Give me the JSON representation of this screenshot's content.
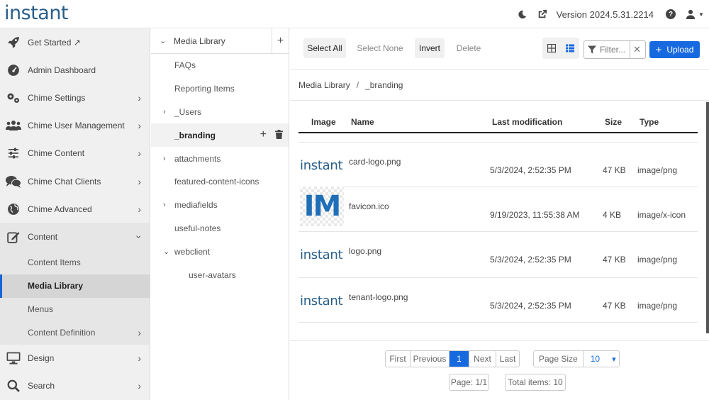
{
  "header": {
    "logo": "instant",
    "version": "Version 2024.5.31.2214"
  },
  "sidebar": {
    "items": [
      {
        "label": "Get Started ↗",
        "icon": "rocket-icon",
        "chevron": false
      },
      {
        "label": "Admin Dashboard",
        "icon": "gauge-icon",
        "chevron": false
      },
      {
        "label": "Chime Settings",
        "icon": "gears-icon",
        "chevron": true
      },
      {
        "label": "Chime User Management",
        "icon": "users-icon",
        "chevron": true
      },
      {
        "label": "Chime Content",
        "icon": "sliders-icon",
        "chevron": true
      },
      {
        "label": "Chime Chat Clients",
        "icon": "chat-icon",
        "chevron": true
      },
      {
        "label": "Chime Advanced",
        "icon": "globe-icon",
        "chevron": true
      },
      {
        "label": "Content",
        "icon": "edit-icon",
        "chevron": true
      }
    ],
    "content_sub": [
      {
        "label": "Content Items"
      },
      {
        "label": "Media Library"
      },
      {
        "label": "Menus"
      },
      {
        "label": "Content Definition"
      }
    ],
    "bottom_items": [
      {
        "label": "Design",
        "icon": "monitor-icon"
      },
      {
        "label": "Search",
        "icon": "search-icon"
      }
    ]
  },
  "tree": {
    "root": "Media Library",
    "rows": [
      {
        "label": "FAQs"
      },
      {
        "label": "Reporting Items"
      },
      {
        "label": "_Users"
      },
      {
        "label": "_branding"
      },
      {
        "label": "attachments"
      },
      {
        "label": "featured-content-icons"
      },
      {
        "label": "mediafields"
      },
      {
        "label": "useful-notes"
      },
      {
        "label": "webclient"
      },
      {
        "label": "user-avatars"
      }
    ]
  },
  "toolbar": {
    "select_all": "Select All",
    "select_none": "Select None",
    "invert": "Invert",
    "delete": "Delete",
    "filter_placeholder": "Filter...",
    "upload": "Upload"
  },
  "breadcrumb": {
    "root": "Media Library",
    "sep": "/",
    "current": "_branding"
  },
  "table": {
    "columns": {
      "image": "Image",
      "name": "Name",
      "modified": "Last modification",
      "size": "Size",
      "type": "Type"
    },
    "rows": [
      {
        "thumb": "instant",
        "name": "card-logo.png",
        "modified": "5/3/2024, 2:52:35 PM",
        "size": "47 KB",
        "type": "image/png"
      },
      {
        "thumb": "IM",
        "name": "favicon.ico",
        "modified": "9/19/2023, 11:55:38 AM",
        "size": "4 KB",
        "type": "image/x-icon"
      },
      {
        "thumb": "instant",
        "name": "logo.png",
        "modified": "5/3/2024, 2:52:35 PM",
        "size": "47 KB",
        "type": "image/png"
      },
      {
        "thumb": "instant",
        "name": "tenant-logo.png",
        "modified": "5/3/2024, 2:52:35 PM",
        "size": "47 KB",
        "type": "image/png"
      }
    ]
  },
  "pager": {
    "first": "First",
    "previous": "Previous",
    "current": "1",
    "next": "Next",
    "last": "Last",
    "page_size_label": "Page Size",
    "page_size_value": "10",
    "page_info": "Page: 1/1",
    "total_items": "Total items: 10"
  },
  "colors": {
    "accent": "#1769e0",
    "logo": "#2a5f8a",
    "sidebar_bg": "#f0f0f0"
  }
}
